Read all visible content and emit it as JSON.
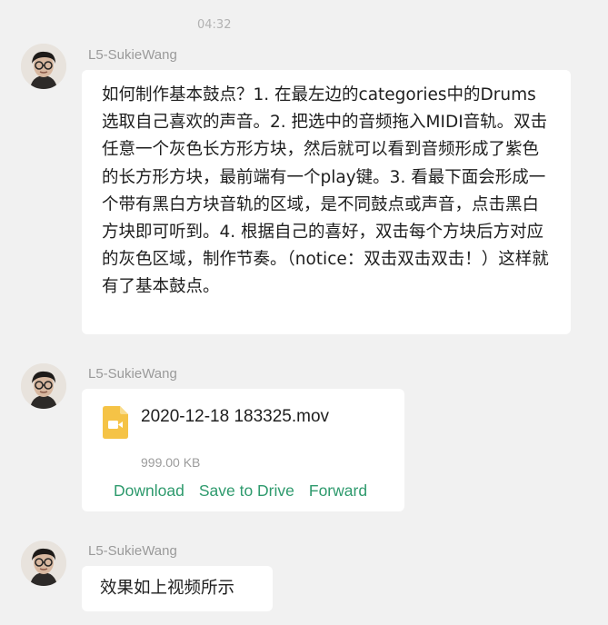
{
  "chat": {
    "timestamp": "04:32",
    "messages": [
      {
        "sender": "L5-SukieWang",
        "text": "如何制作基本鼓点？1. 在最左边的categories中的Drums选取自己喜欢的声音。2. 把选中的音频拖入MIDI音轨。双击任意一个灰色长方形方块，然后就可以看到音频形成了紫色的长方形方块，最前端有一个play键。3. 看最下面会形成一个带有黑白方块音轨的区域，是不同鼓点或声音，点击黑白方块即可听到。4. 根据自己的喜好，双击每个方块后方对应的灰色区域，制作节奏。（notice：双击双击双击！）这样就有了基本鼓点。"
      },
      {
        "sender": "L5-SukieWang",
        "file": {
          "name": "2020-12-18 183325.mov",
          "size": "999.00 KB",
          "icon": "video-file-icon",
          "icon_color": "#f5c346",
          "actions": [
            "Download",
            "Save to Drive",
            "Forward"
          ]
        }
      },
      {
        "sender": "L5-SukieWang",
        "text": "效果如上视频所示"
      }
    ]
  },
  "colors": {
    "background": "#f1f1f1",
    "bubble": "#ffffff",
    "link": "#2e9a6d",
    "sender": "#9a9a9a"
  }
}
